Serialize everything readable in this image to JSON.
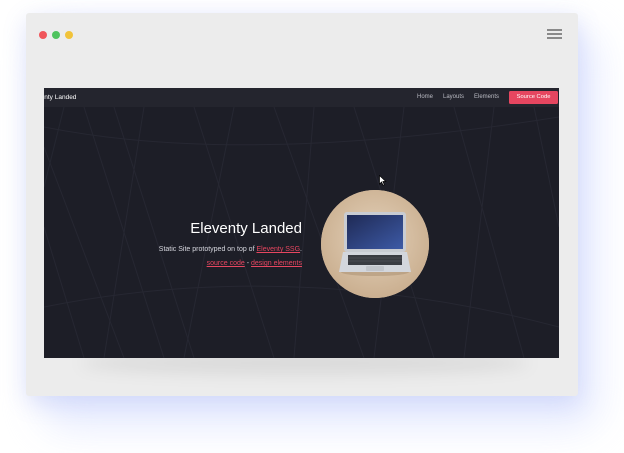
{
  "window": {
    "controls": [
      "close",
      "minimize",
      "maximize"
    ],
    "menu_icon": "hamburger-menu-icon"
  },
  "site": {
    "brand": "Eleventy Landed",
    "nav": [
      {
        "label": "Home"
      },
      {
        "label": "Layouts"
      },
      {
        "label": "Elements"
      }
    ],
    "cta": "Source Code"
  },
  "hero": {
    "title": "Eleventy Landed",
    "line1_prefix": "Static Site prototyped on top of ",
    "line1_link": "Eleventy SSG",
    "line1_suffix": ".",
    "line2_link1": "source code",
    "line2_sep": " - ",
    "line2_link2": "design elements",
    "image": "laptop-photo"
  },
  "colors": {
    "accent": "#e64660",
    "page_bg": "#1d1e27",
    "navbar_bg": "#24252e",
    "frame_bg": "#ececec"
  }
}
